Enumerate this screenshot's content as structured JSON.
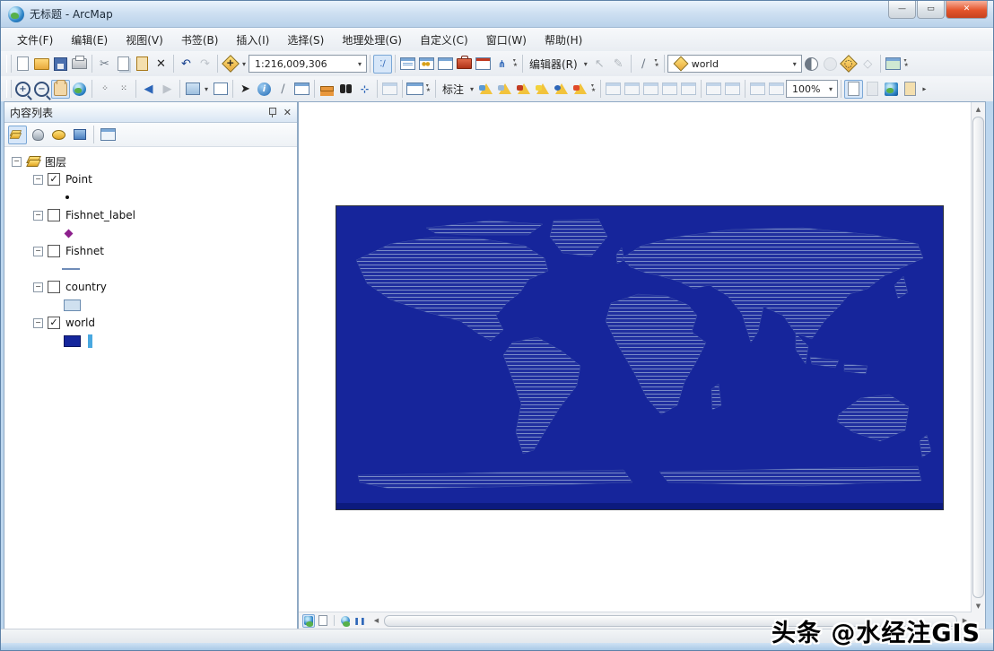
{
  "window": {
    "title": "无标题 - ArcMap",
    "controls": {
      "minimize": "—",
      "maximize": "▭",
      "close": "✕"
    }
  },
  "menu": {
    "items": [
      {
        "label": "文件(F)"
      },
      {
        "label": "编辑(E)"
      },
      {
        "label": "视图(V)"
      },
      {
        "label": "书签(B)"
      },
      {
        "label": "插入(I)"
      },
      {
        "label": "选择(S)"
      },
      {
        "label": "地理处理(G)"
      },
      {
        "label": "自定义(C)"
      },
      {
        "label": "窗口(W)"
      },
      {
        "label": "帮助(H)"
      }
    ]
  },
  "toolbars": {
    "scale_value": "1:216,009,306",
    "editor_label": "编辑器(R)",
    "effects_layer_value": "world",
    "labeling_label": "标注",
    "layout_zoom_value": "100%"
  },
  "toc": {
    "title": "内容列表",
    "group_label": "图层",
    "layers": [
      {
        "name": "Point",
        "check": "✓",
        "symbol": "point"
      },
      {
        "name": "Fishnet_label",
        "check": "",
        "symbol": "purple-diamond"
      },
      {
        "name": "Fishnet",
        "check": "",
        "symbol": "line"
      },
      {
        "name": "country",
        "check": "",
        "symbol": "light-blue-fill"
      },
      {
        "name": "world",
        "check": "✓",
        "symbol": "dark-blue-fill"
      }
    ]
  },
  "map": {
    "colors": {
      "ocean": "#16259b",
      "land": "#202f9f",
      "hatch": "#8396cc",
      "frame_bottom": "#0c1a7e"
    }
  },
  "watermark": {
    "text": "头条 @水经注GIS"
  }
}
